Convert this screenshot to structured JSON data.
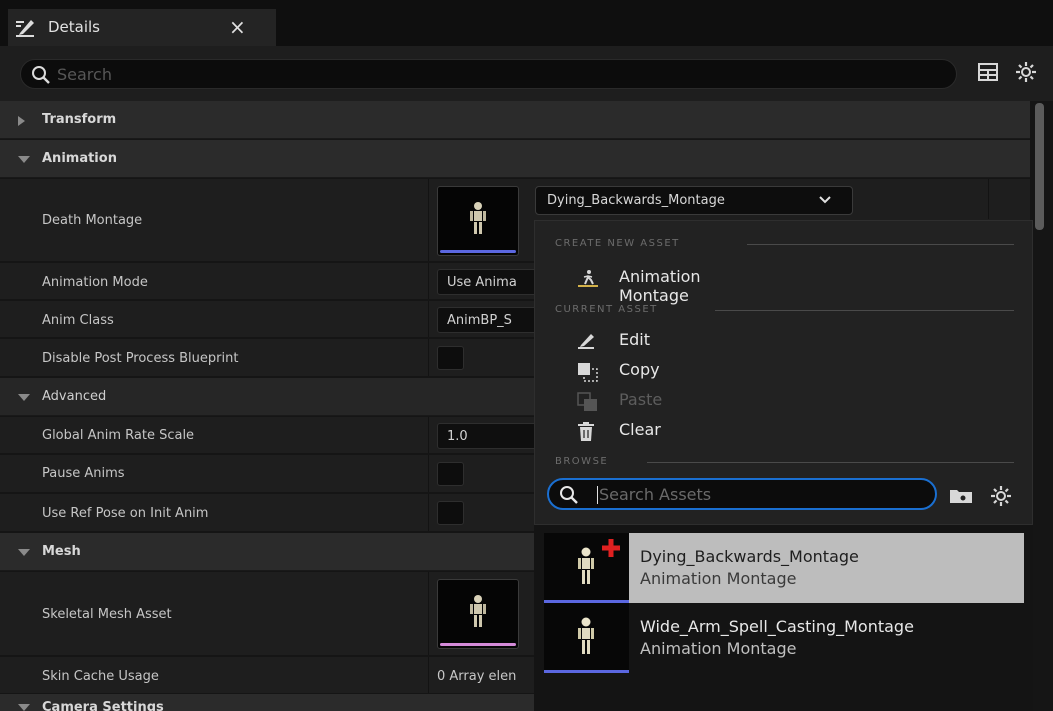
{
  "window": {
    "tab_label": "Details",
    "tab_close": "×"
  },
  "search": {
    "placeholder": "Search"
  },
  "categories": {
    "transform": "Transform",
    "animation": "Animation",
    "advanced": "Advanced",
    "mesh": "Mesh",
    "camera_settings": "Camera Settings"
  },
  "properties": {
    "death_montage": {
      "label": "Death Montage",
      "value": "Dying_Backwards_Montage"
    },
    "animation_mode": {
      "label": "Animation Mode",
      "value": "Use Anima"
    },
    "anim_class": {
      "label": "Anim Class",
      "value": "AnimBP_S"
    },
    "disable_post_process": {
      "label": "Disable Post Process Blueprint",
      "checked": false
    },
    "global_anim_rate": {
      "label": "Global Anim Rate Scale",
      "value": "1.0"
    },
    "pause_anims": {
      "label": "Pause Anims",
      "checked": false
    },
    "use_ref_pose": {
      "label": "Use Ref Pose on Init Anim",
      "checked": false
    },
    "skeletal_mesh": {
      "label": "Skeletal Mesh Asset"
    },
    "skin_cache": {
      "label": "Skin Cache Usage",
      "value": "0 Array elen"
    }
  },
  "menu": {
    "create_new_asset": "CREATE NEW ASSET",
    "animation_montage": "Animation Montage",
    "current_asset": "CURRENT ASSET",
    "edit": "Edit",
    "copy": "Copy",
    "paste": "Paste",
    "clear": "Clear",
    "browse": "BROWSE",
    "search_placeholder": "Search Assets"
  },
  "assets": [
    {
      "name": "Dying_Backwards_Montage",
      "type": "Animation Montage",
      "selected": true
    },
    {
      "name": "Wide_Arm_Spell_Casting_Montage",
      "type": "Animation Montage",
      "selected": false
    }
  ],
  "colors": {
    "accent_blue": "#1a6fd1",
    "thumb_bar_blue": "#5b67e0",
    "thumb_bar_pink": "#d48ad8",
    "plus_red": "#e02020"
  }
}
